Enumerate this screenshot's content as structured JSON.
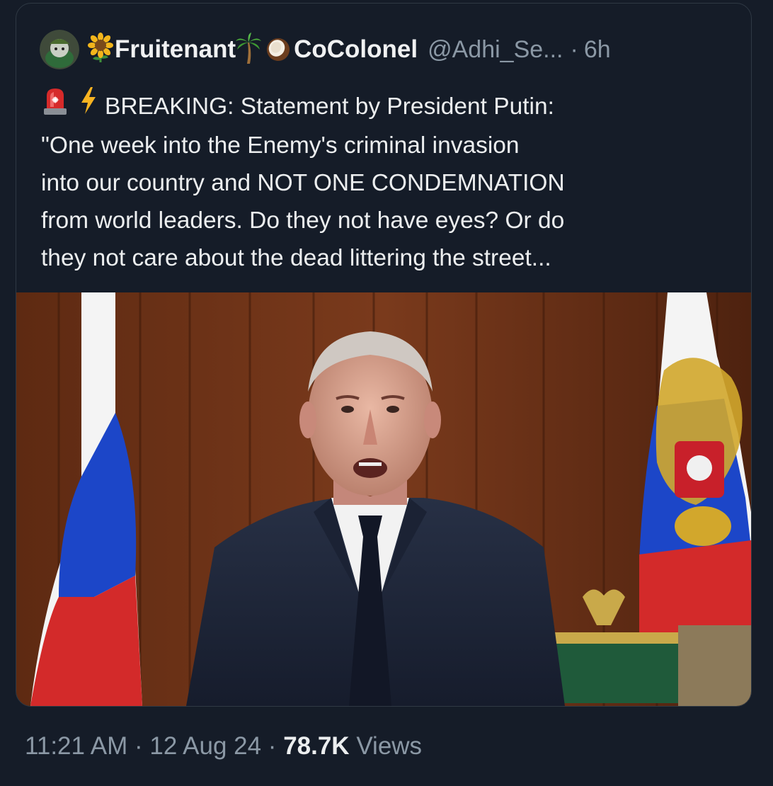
{
  "tweet": {
    "display_name_part1": "Fruitenant",
    "display_name_part2": "CoColonel",
    "handle": "@Adhi_Se...",
    "separator": "·",
    "relative_time": "6h",
    "text_line1": "BREAKING: Statement by President Putin:",
    "text_line2": "\"One week into the Enemy's criminal invasion",
    "text_line3": "into our country and NOT ONE CONDEMNATION",
    "text_line4": "from world leaders. Do they not have eyes? Or do",
    "text_line5": "they not care about the dead littering the street...",
    "icons": [
      "avatar",
      "sunflower-icon",
      "palm-tree-icon",
      "coconut-icon",
      "siren-icon",
      "lightning-icon"
    ]
  },
  "footer": {
    "time": "11:21 AM",
    "separator": "·",
    "date": "12 Aug 24",
    "views_count": "78.7K",
    "views_label": "Views"
  },
  "colors": {
    "background": "#151c28",
    "muted_text": "#8b98a5",
    "text": "#e7e9ea"
  }
}
